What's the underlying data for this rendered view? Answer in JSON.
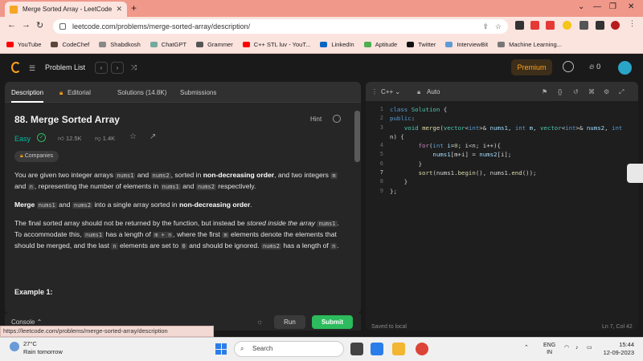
{
  "browser": {
    "tab_title": "Merge Sorted Array - LeetCode",
    "tab_close": "✕",
    "new_tab": "+",
    "url": "leetcode.com/problems/merge-sorted-array/description/",
    "status_link": "https://leetcode.com/problems/merge-sorted-array/description",
    "bookmarks": [
      {
        "label": "YouTube",
        "color": "#ff0000"
      },
      {
        "label": "CodeChef",
        "color": "#5b4638"
      },
      {
        "label": "Shabdkosh",
        "color": "#888888"
      },
      {
        "label": "ChatGPT",
        "color": "#74aa9c"
      },
      {
        "label": "Grammer",
        "color": "#555555"
      },
      {
        "label": "C++ STL luv - YouT...",
        "color": "#ff0000"
      },
      {
        "label": "LinkedIn",
        "color": "#0a66c2"
      },
      {
        "label": "Aptitude",
        "color": "#4caf50"
      },
      {
        "label": "Twitter",
        "color": "#111111"
      },
      {
        "label": "InterviewBit",
        "color": "#5e9bd6"
      },
      {
        "label": "Machine Learning...",
        "color": "#777777"
      }
    ]
  },
  "header": {
    "problem_list": "Problem List",
    "premium": "Premium",
    "streak_count": "0"
  },
  "left": {
    "tabs": [
      "Description",
      "Editorial",
      "Solutions (14.8K)",
      "Submissions"
    ],
    "title": "88. Merge Sorted Array",
    "hint": "Hint",
    "difficulty": "Easy",
    "likes": "12.5K",
    "dislikes": "1.4K",
    "companies": "Companies",
    "example_heading": "Example 1:"
  },
  "bottom": {
    "console": "Console",
    "run": "Run",
    "submit": "Submit"
  },
  "editor": {
    "language": "C++",
    "auto": "Auto",
    "line_numbers": [
      "1",
      "2",
      "3",
      "",
      "4",
      "5",
      "6",
      "7",
      "8",
      "9"
    ],
    "saved": "Saved to local",
    "position": "Ln 7, Col 42"
  },
  "taskbar": {
    "temperature": "27°C",
    "weather": "Rain tomorrow",
    "search": "Search",
    "lang_top": "ENG",
    "lang_bottom": "IN",
    "time": "15:44",
    "date": "12-09-2023"
  },
  "colors": {
    "accent": "#ffa116",
    "easy": "#00b8a3",
    "submit": "#2cbb5d",
    "tabstrip": "#f0988a"
  }
}
